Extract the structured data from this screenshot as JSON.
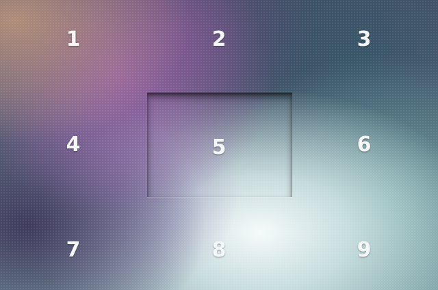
{
  "grid": {
    "cells": [
      {
        "label": "1"
      },
      {
        "label": "2"
      },
      {
        "label": "3"
      },
      {
        "label": "4"
      },
      {
        "label": "5"
      },
      {
        "label": "6"
      },
      {
        "label": "7"
      },
      {
        "label": "8"
      },
      {
        "label": "9"
      }
    ],
    "highlighted_cell": "5"
  },
  "colors": {
    "text": "#f5f6f8",
    "purple_glow": "#965fa5",
    "teal_glow": "#69a0a0",
    "light_glow": "#f5fafa"
  }
}
